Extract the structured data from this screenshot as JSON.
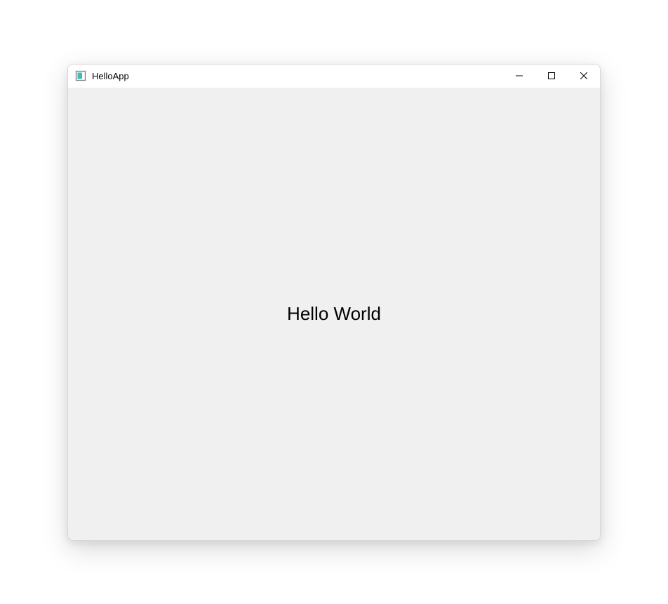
{
  "window": {
    "title": "HelloApp"
  },
  "content": {
    "greeting": "Hello World"
  }
}
